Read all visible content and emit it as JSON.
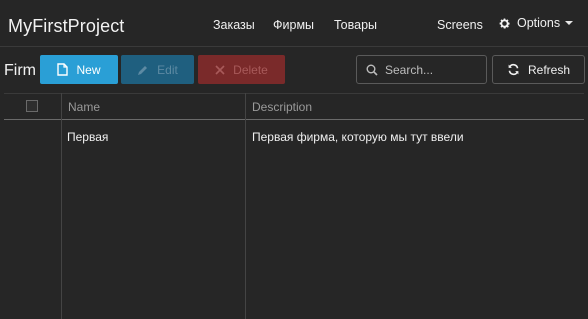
{
  "header": {
    "brand": "MyFirstProject",
    "nav": [
      "Заказы",
      "Фирмы",
      "Товары"
    ],
    "screens": "Screens",
    "options": "Options"
  },
  "toolbar": {
    "page_label": "Firm",
    "new_label": "New",
    "edit_label": "Edit",
    "delete_label": "Delete",
    "search_placeholder": "Search...",
    "refresh_label": "Refresh"
  },
  "table": {
    "columns": [
      "Name",
      "Description"
    ],
    "rows": [
      {
        "name": "Первая",
        "description": "Первая фирма, которую мы тут ввели"
      }
    ]
  },
  "colors": {
    "background": "#262626",
    "primary": "#2a9fd6",
    "danger": "#7a2a2a"
  },
  "icons": {
    "new": "document-icon",
    "edit": "pencil-icon",
    "delete": "close-icon",
    "search": "search-icon",
    "refresh": "refresh-icon",
    "options": "gear-icon"
  }
}
